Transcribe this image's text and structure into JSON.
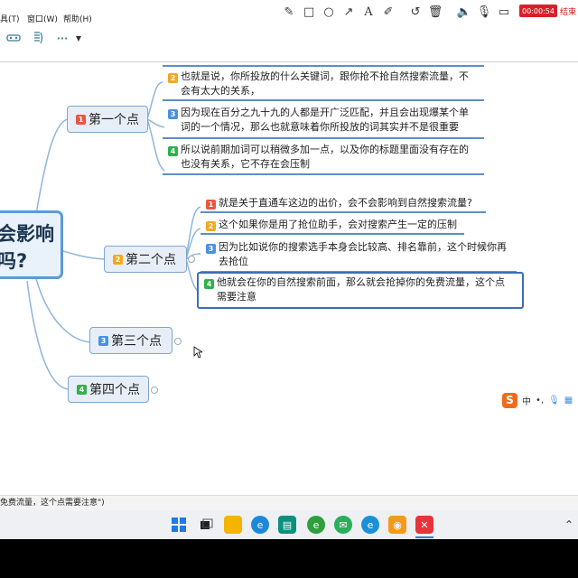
{
  "menu": {
    "items": [
      "具(T)",
      "窗口(W)",
      "帮助(H)"
    ]
  },
  "recorder": {
    "tools": [
      "pen-icon",
      "square-icon",
      "circle-icon",
      "arrow-icon",
      "text-icon",
      "highlighter-icon",
      "undo-icon",
      "trash-icon",
      "speaker-icon",
      "mic-icon",
      "camera-icon"
    ],
    "timer": "00:00:54",
    "end_label": "结束"
  },
  "toolbar": {
    "more_label": "···"
  },
  "mindmap": {
    "central": {
      "line1": "会影响",
      "line2": "吗?"
    },
    "topics": [
      {
        "badge": "1",
        "label": "第一个点"
      },
      {
        "badge": "2",
        "label": "第二个点"
      },
      {
        "badge": "3",
        "label": "第三个点"
      },
      {
        "badge": "4",
        "label": "第四个点"
      }
    ],
    "topic1_subs": [
      {
        "badge": "2",
        "line1": "也就是说，你所投放的什么关键词，跟你抢不抢自然搜索流量，不",
        "line2": "会有太大的关系，"
      },
      {
        "badge": "3",
        "line1": "因为现在百分之九十九的人都是开广泛匹配，并且会出现爆某个单",
        "line2": "词的一个情况，那么也就意味着你所投放的词其实并不是很重要"
      },
      {
        "badge": "4",
        "line1": "所以说前期加词可以稍微多加一点，以及你的标题里面没有存在的",
        "line2": "也没有关系，它不存在会压制"
      }
    ],
    "topic2_subs": [
      {
        "badge": "1",
        "line1": "就是关于直通车这边的出价，会不会影响到自然搜索流量?",
        "line2": ""
      },
      {
        "badge": "2",
        "line1": "这个如果你是用了抢位助手，会对搜索产生一定的压制",
        "line2": ""
      },
      {
        "badge": "3",
        "line1": "因为比如说你的搜索选手本身会比较高、排名靠前，这个时候你再",
        "line2": "去抢位"
      },
      {
        "badge": "4",
        "line1": "他就会在你的自然搜索前面，那么就会抢掉你的免费流量，这个点",
        "line2": "需要注意"
      }
    ]
  },
  "ime": {
    "logo": "S",
    "lang": "中",
    "punct": "•,"
  },
  "status": {
    "text": "免费流量，这个点需要注意\")"
  },
  "taskbar": {
    "apps": [
      "windows-start-icon",
      "task-view-icon",
      "file-explorer-icon",
      "edge-browser-icon",
      "store-icon",
      "ie-browser-icon",
      "wechat-icon",
      "ie-alt-icon",
      "photo-app-icon",
      "xmind-icon"
    ]
  },
  "colors": {
    "accent": "#5a9bd8",
    "branch": "#6fa3d6",
    "recorder_red": "#d8202a"
  }
}
